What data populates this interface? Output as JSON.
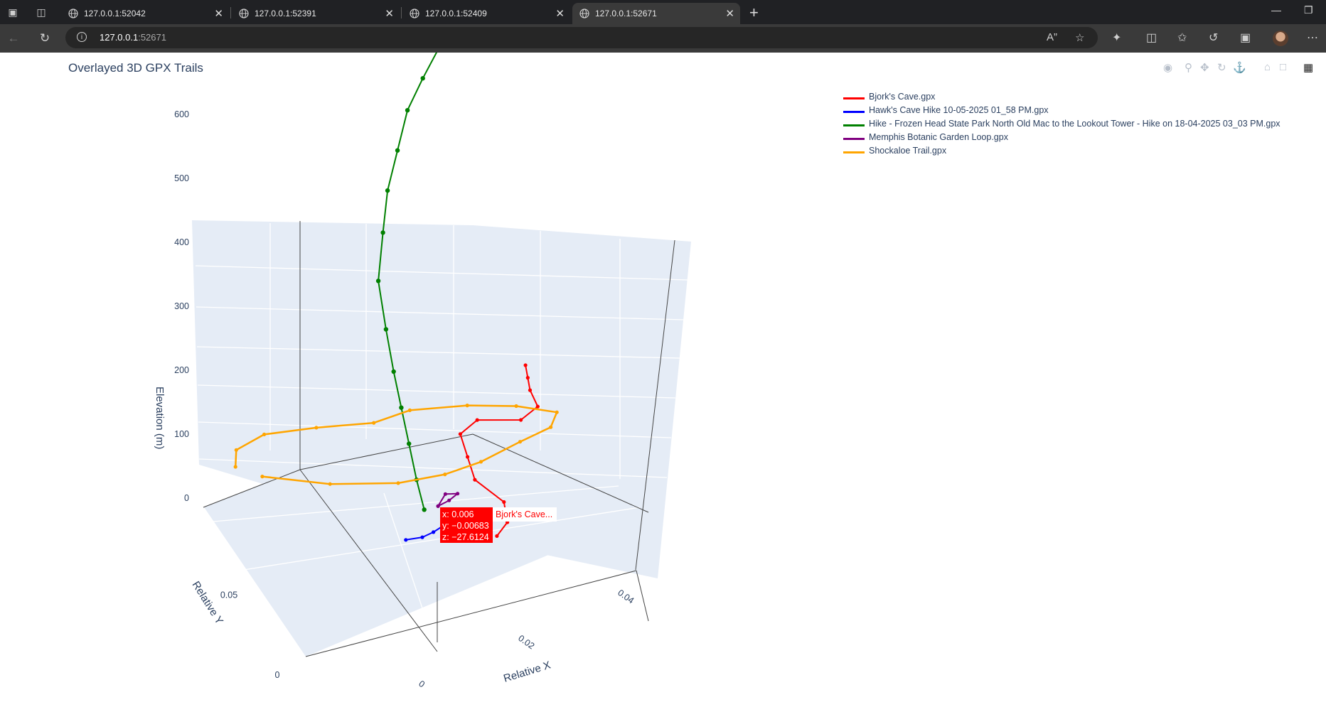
{
  "browser": {
    "tabs": [
      {
        "title": "127.0.0.1:52042",
        "active": false
      },
      {
        "title": "127.0.0.1:52391",
        "active": false
      },
      {
        "title": "127.0.0.1:52409",
        "active": false
      },
      {
        "title": "127.0.0.1:52671",
        "active": true
      }
    ],
    "address_host": "127.0.0.1",
    "address_port": ":52671",
    "icons": [
      "workspaces-icon",
      "tab-actions-icon",
      "globe-icon",
      "close-icon",
      "plus-icon",
      "minimize-icon",
      "restore-icon",
      "back-icon",
      "refresh-icon",
      "info-icon",
      "read-aloud-icon",
      "favorite-star-icon",
      "extensions-icon",
      "split-screen-icon",
      "favorites-icon",
      "history-icon",
      "screenshot-icon",
      "profile-avatar",
      "more-icon"
    ]
  },
  "plot": {
    "title": "Overlayed 3D GPX Trails",
    "modebar_icons": [
      "camera-icon",
      "zoom-icon",
      "pan-icon",
      "orbit-icon",
      "turntable-icon",
      "home-icon",
      "reset-camera-icon",
      "plotly-logo-icon"
    ]
  },
  "legend": [
    {
      "name": "Bjork's Cave.gpx",
      "color": "#ff0000"
    },
    {
      "name": "Hawk's Cave Hike 10-05-2025 01_58 PM.gpx",
      "color": "#0000ff"
    },
    {
      "name": "Hike - Frozen Head State Park North Old Mac to the Lookout Tower - Hike on 18-04-2025 03_03 PM.gpx",
      "color": "#008000"
    },
    {
      "name": "Memphis Botanic Garden Loop.gpx",
      "color": "#800080"
    },
    {
      "name": "Shockaloe Trail.gpx",
      "color": "#ffa500"
    }
  ],
  "chart_data": {
    "type": "scatter3d-lines",
    "title": "Overlayed 3D GPX Trails",
    "xlabel": "Relative X",
    "ylabel": "Relative Y",
    "zlabel": "Elevation (m)",
    "x_ticks": [
      "0",
      "0.02",
      "0.04"
    ],
    "y_ticks": [
      "0",
      "0.05"
    ],
    "z_ticks": [
      "0",
      "100",
      "200",
      "300",
      "400",
      "500",
      "600"
    ],
    "xlim": [
      0,
      0.045
    ],
    "ylim": [
      0,
      0.085
    ],
    "zlim": [
      -30,
      600
    ],
    "series": [
      {
        "name": "Bjork's Cave.gpx",
        "color": "#ff0000",
        "x": [
          0.006,
          0.009,
          0.012,
          0.014,
          0.018,
          0.022,
          0.026,
          0.03,
          0.034,
          0.036,
          0.038,
          0.04
        ],
        "y": [
          -0.00683,
          -0.003,
          0.006,
          0.022,
          0.035,
          0.048,
          0.052,
          0.046,
          0.05,
          0.058,
          0.064,
          0.07
        ],
        "z": [
          -27.6,
          -20,
          -10,
          -5,
          0,
          5,
          10,
          8,
          12,
          20,
          25,
          30
        ]
      },
      {
        "name": "Hawk's Cave Hike 10-05-2025 01_58 PM.gpx",
        "color": "#0000ff",
        "x": [
          -0.003,
          -0.001,
          0.001,
          0.003,
          0.005
        ],
        "y": [
          0.004,
          0.003,
          0.004,
          0.006,
          0.008
        ],
        "z": [
          -25,
          -25,
          -24,
          -24,
          -23
        ]
      },
      {
        "name": "Hike - Frozen Head State Park North Old Mac to the Lookout Tower - Hike on 18-04-2025 03_03 PM.gpx",
        "color": "#008000",
        "x": [
          0.002,
          0.004,
          0.006,
          0.008,
          0.01,
          0.012,
          0.014,
          0.017,
          0.02,
          0.023,
          0.026,
          0.029,
          0.032
        ],
        "y": [
          0.01,
          0.018,
          0.026,
          0.034,
          0.042,
          0.05,
          0.058,
          0.064,
          0.07,
          0.074,
          0.078,
          0.08,
          0.082
        ],
        "z": [
          0,
          30,
          70,
          110,
          150,
          200,
          260,
          320,
          370,
          420,
          470,
          510,
          545
        ]
      },
      {
        "name": "Memphis Botanic Garden Loop.gpx",
        "color": "#800080",
        "x": [
          0.004,
          0.006,
          0.008,
          0.007,
          0.004
        ],
        "y": [
          0.01,
          0.011,
          0.013,
          0.015,
          0.01
        ],
        "z": [
          0,
          2,
          4,
          3,
          0
        ]
      },
      {
        "name": "Shockaloe Trail.gpx",
        "color": "#ffa500",
        "x": [
          -0.004,
          0.0,
          0.006,
          0.012,
          0.018,
          0.024,
          0.03,
          0.034,
          0.036,
          0.032,
          0.026,
          0.018,
          0.012,
          0.006,
          0.0,
          -0.004
        ],
        "y": [
          0.065,
          0.075,
          0.08,
          0.076,
          0.07,
          0.072,
          0.066,
          0.058,
          0.048,
          0.04,
          0.036,
          0.03,
          0.028,
          0.03,
          0.04,
          0.055
        ],
        "z": [
          0,
          0,
          0,
          0,
          0,
          0,
          0,
          0,
          0,
          0,
          0,
          0,
          0,
          0,
          0,
          0
        ]
      }
    ],
    "hover": {
      "series": "Bjork's Cave...",
      "lines": [
        "x: 0.006",
        "y: −0.00683",
        "z: −27.6124"
      ],
      "color": "#ff0000"
    }
  }
}
